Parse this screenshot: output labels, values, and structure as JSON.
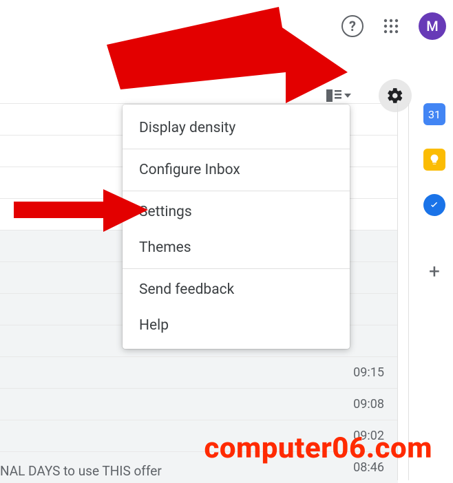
{
  "header": {
    "avatar_letter": "M"
  },
  "menu": {
    "items": [
      "Display density",
      "Configure Inbox",
      "Settings",
      "Themes",
      "Send feedback",
      "Help"
    ]
  },
  "sidepanel": {
    "calendar_day": "31"
  },
  "timestamps": [
    "09:15",
    "09:08",
    "09:02",
    "08:46"
  ],
  "snippet": "NAL DAYS to use THIS offer",
  "watermark": "computer06.com"
}
